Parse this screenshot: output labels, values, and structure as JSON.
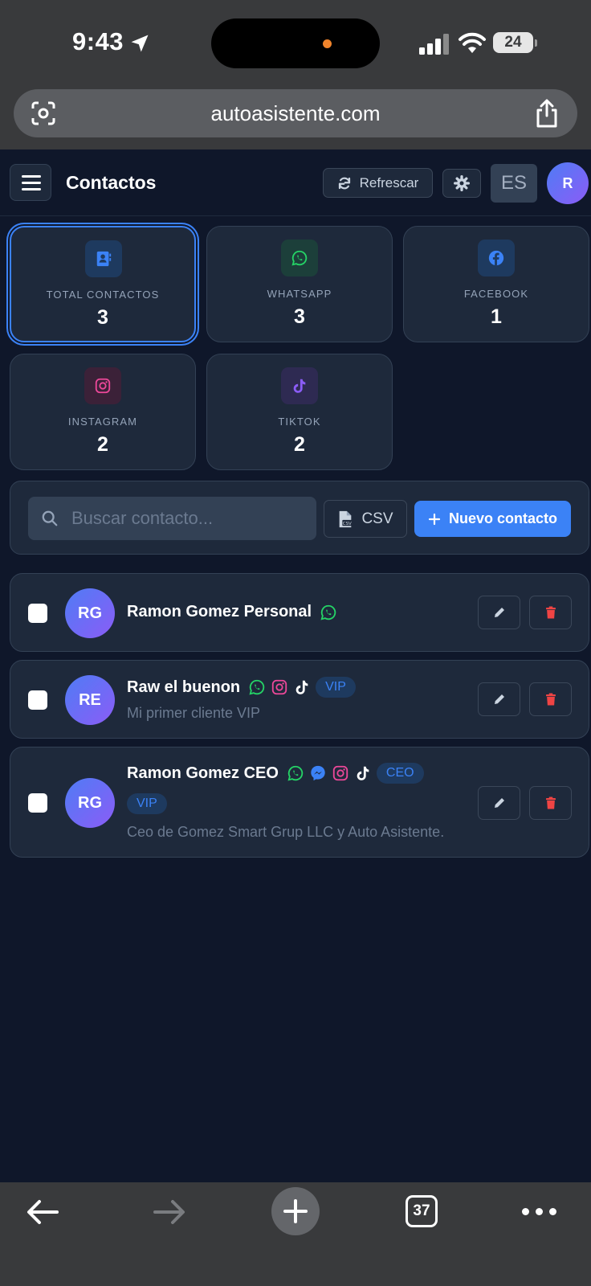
{
  "status_bar": {
    "time": "9:43",
    "battery": "24"
  },
  "browser": {
    "url": "autoasistente.com",
    "tab_count": "37"
  },
  "header": {
    "title": "Contactos",
    "refresh_label": "Refrescar",
    "lang_label": "ES",
    "avatar_initial": "R"
  },
  "stats": [
    {
      "label": "TOTAL CONTACTOS",
      "value": "3",
      "icon": "contacts-icon",
      "color": "#3b82f6"
    },
    {
      "label": "WHATSAPP",
      "value": "3",
      "icon": "whatsapp-icon",
      "color": "#25d366"
    },
    {
      "label": "FACEBOOK",
      "value": "1",
      "icon": "facebook-icon",
      "color": "#3b82f6"
    },
    {
      "label": "INSTAGRAM",
      "value": "2",
      "icon": "instagram-icon",
      "color": "#ec4899"
    },
    {
      "label": "TIKTOK",
      "value": "2",
      "icon": "tiktok-icon",
      "color": "#8b5cf6"
    }
  ],
  "toolbar": {
    "search_placeholder": "Buscar contacto...",
    "csv_label": "CSV",
    "new_contact_label": "Nuevo contacto"
  },
  "contacts": [
    {
      "initials": "RG",
      "name": "Ramon Gomez Personal",
      "channels": [
        "whatsapp-icon"
      ],
      "tags": [],
      "note": ""
    },
    {
      "initials": "RE",
      "name": "Raw el buenon",
      "channels": [
        "whatsapp-icon",
        "instagram-icon",
        "tiktok-icon"
      ],
      "tags": [
        "VIP"
      ],
      "note": "Mi primer cliente VIP"
    },
    {
      "initials": "RG",
      "name": "Ramon Gomez CEO",
      "channels": [
        "whatsapp-icon",
        "messenger-icon",
        "instagram-icon",
        "tiktok-icon"
      ],
      "tags": [
        "CEO",
        "VIP"
      ],
      "note": "Ceo de Gomez Smart Grup LLC y Auto Asistente."
    }
  ],
  "colors": {
    "background": "#0f172a",
    "card": "#1e293b",
    "accent": "#3b82f6",
    "danger": "#ef4444",
    "whatsapp": "#25d366",
    "instagram": "#ec4899"
  }
}
